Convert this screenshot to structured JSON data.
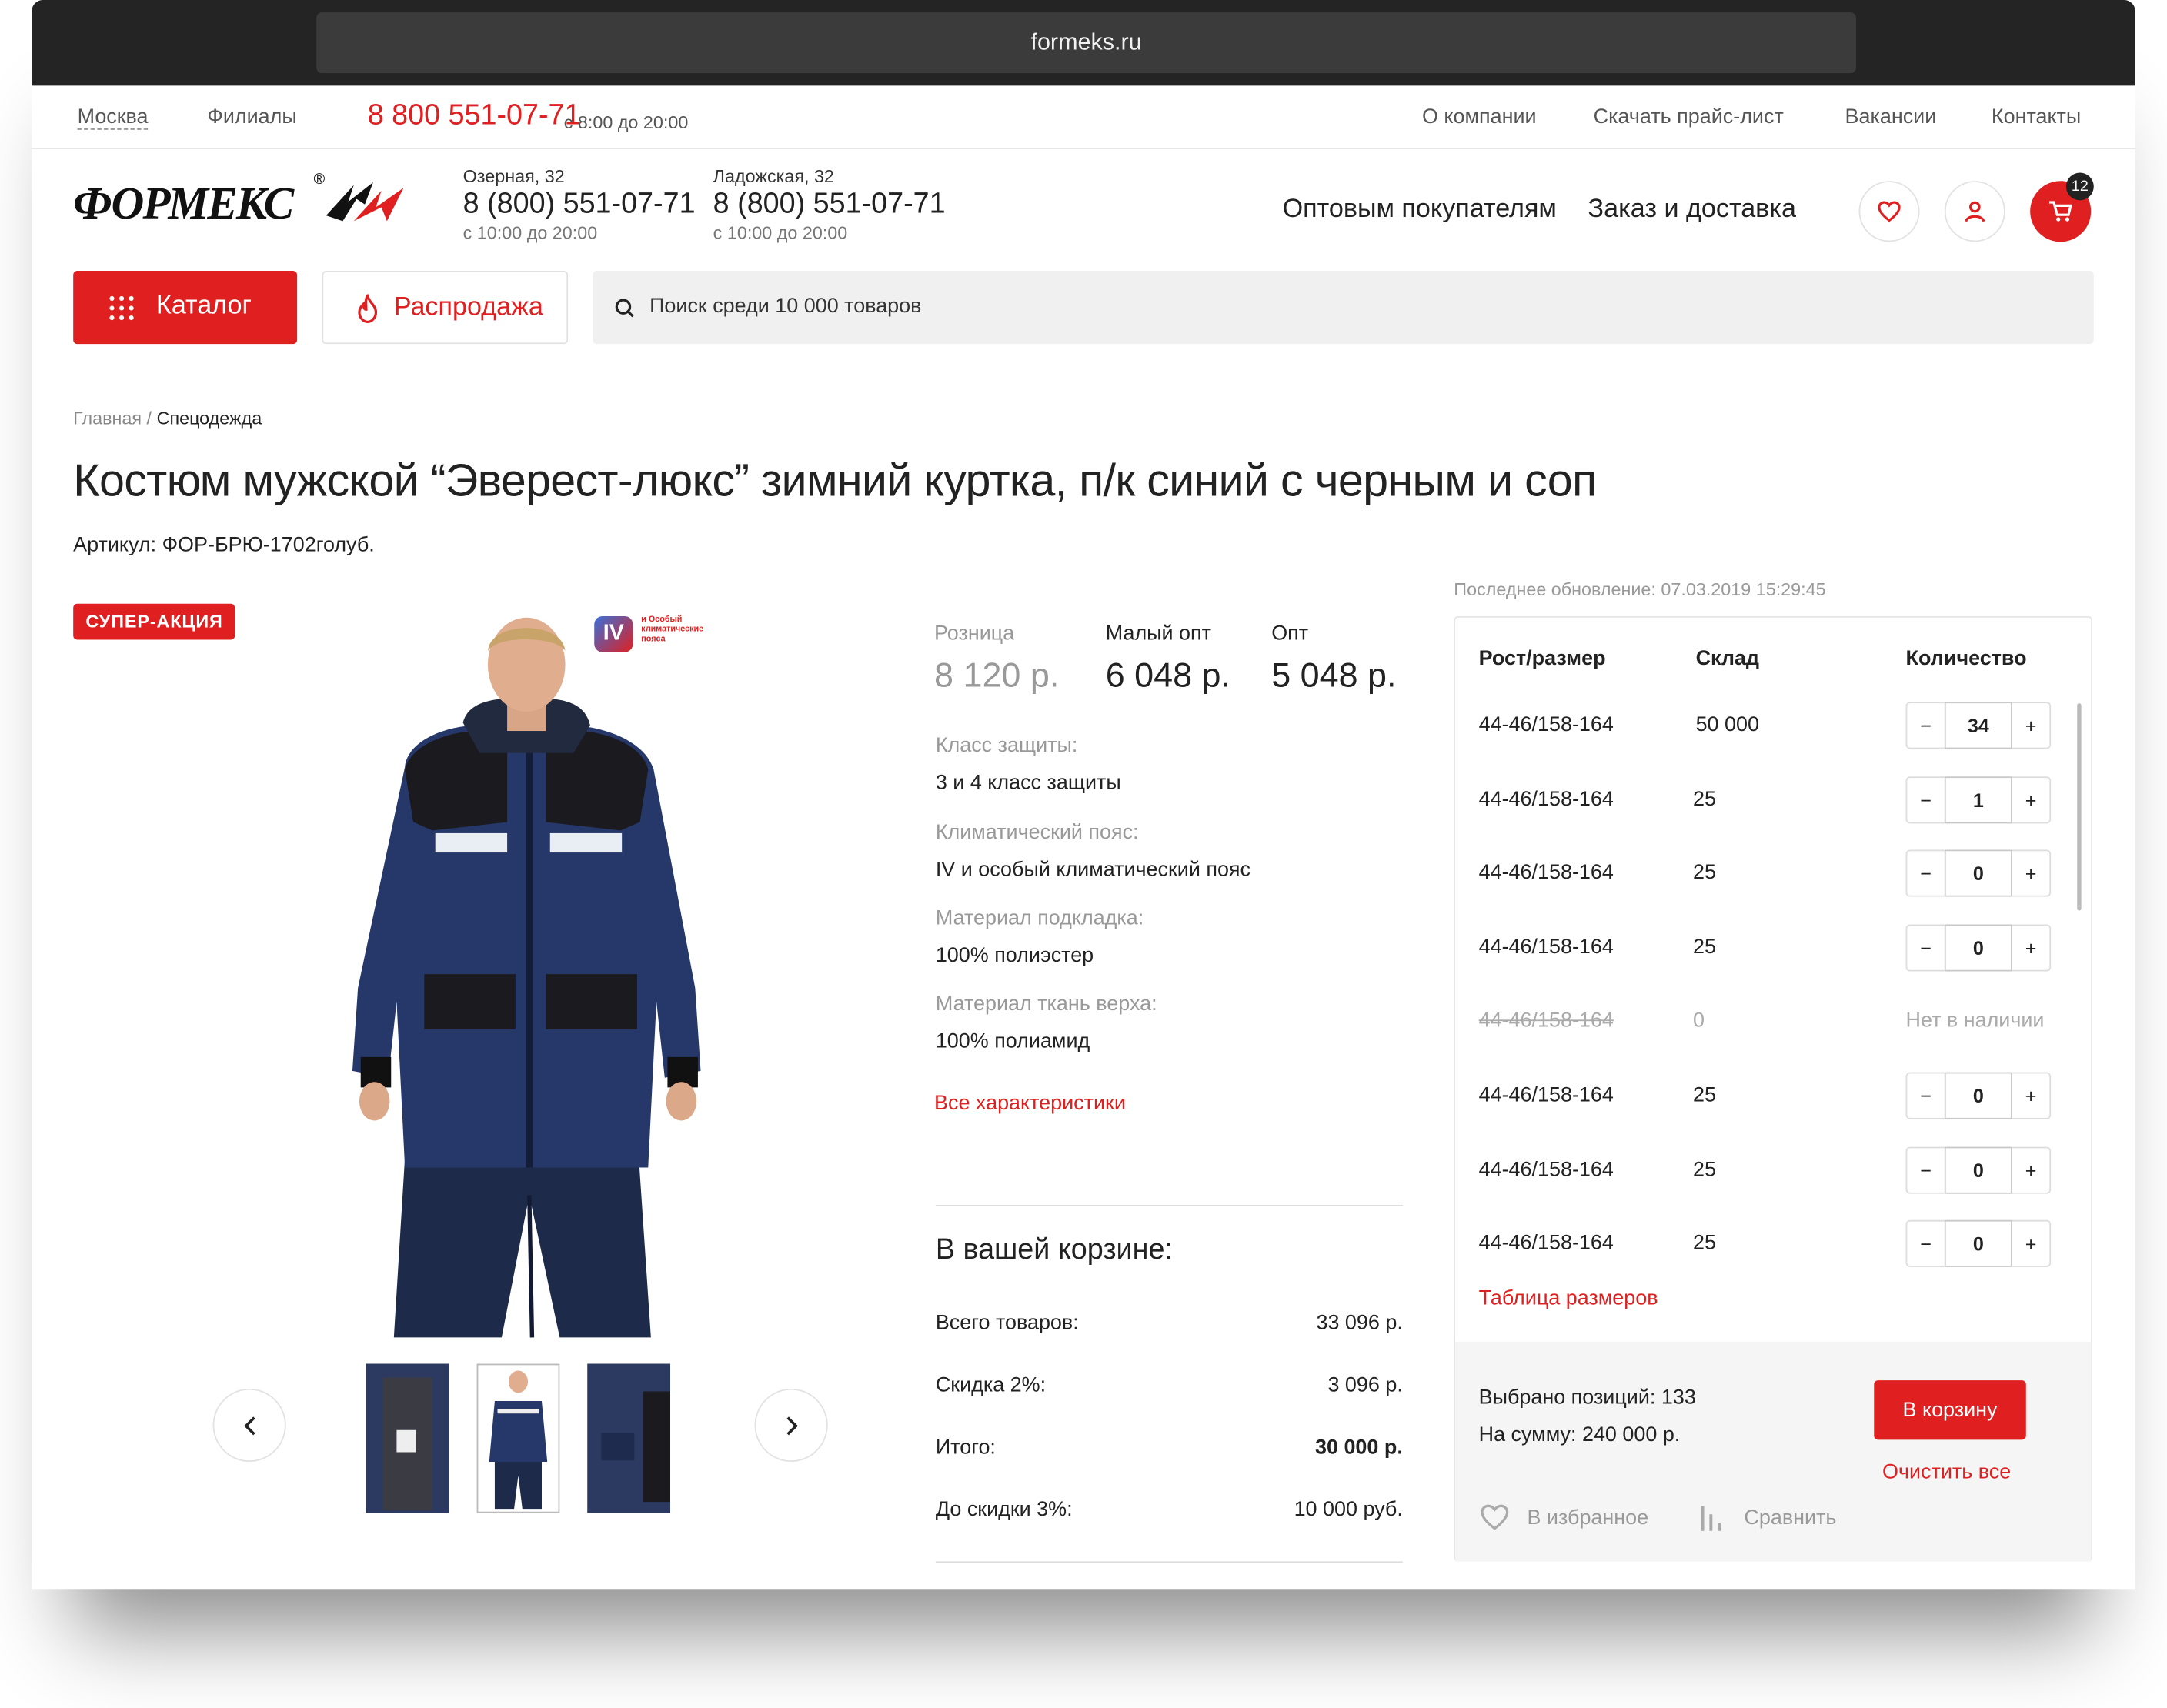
{
  "browser": {
    "url": "formeks.ru"
  },
  "topbar": {
    "city": "Москва",
    "branches": "Филиалы",
    "phone": "8 800 551-07-71",
    "hours": "с 8:00 до 20:00",
    "links": [
      "О компании",
      "Скачать прайс-лист",
      "Вакансии",
      "Контакты"
    ]
  },
  "header": {
    "logo_text": "ФОРМЕКС",
    "stores": [
      {
        "address": "Озерная, 32",
        "phone": "8 (800) 551-07-71",
        "hours": "с 10:00 до 20:00"
      },
      {
        "address": "Ладожская, 32",
        "phone": "8 (800) 551-07-71",
        "hours": "с 10:00 до 20:00"
      }
    ],
    "nav": [
      "Оптовым покупателям",
      "Заказ и доставка"
    ],
    "cart_count": "12"
  },
  "toolbar": {
    "catalog_label": "Каталог",
    "sale_label": "Распродажа",
    "search_placeholder": "Поиск среди 10 000 товаров"
  },
  "breadcrumb": {
    "home": "Главная",
    "separator": "/",
    "current": "Спецодежда"
  },
  "product": {
    "title": "Костюм мужской “Эверест-люкс” зимний куртка, п/к синий с черным и соп",
    "article": "Артикул: ФОР-БРЮ-1702голуб.",
    "badge": "СУПЕР-АКЦИЯ",
    "climate_badge": {
      "numeral": "IV",
      "text": "и Особый климатические пояса"
    },
    "prices": [
      {
        "label": "Розница",
        "value": "8 120 р."
      },
      {
        "label": "Малый опт",
        "value": "6 048 р."
      },
      {
        "label": "Опт",
        "value": "5 048 р."
      }
    ],
    "specs": [
      {
        "label": "Класс защиты:",
        "value": "3 и 4 класс защиты"
      },
      {
        "label": "Климатический пояс:",
        "value": "IV и особый климатический пояс"
      },
      {
        "label": "Материал подкладка:",
        "value": "100% полиэстер"
      },
      {
        "label": "Материал ткань верха:",
        "value": "100% полиамид"
      }
    ],
    "all_specs_link": "Все характеристики"
  },
  "cart_summary": {
    "title": "В вашей корзине:",
    "rows": [
      {
        "label": "Всего товаров:",
        "value": "33 096 р."
      },
      {
        "label": "Скидка 2%:",
        "value": "3 096 р."
      },
      {
        "label": "Итого:",
        "value": "30 000 р."
      },
      {
        "label": "До скидки 3%:",
        "value": "10 000 руб."
      }
    ]
  },
  "sizes": {
    "last_update": "Последнее обновление: 07.03.2019 15:29:45",
    "headers": [
      "Рост/размер",
      "Склад",
      "Количество"
    ],
    "rows": [
      {
        "size": "44-46/158-164",
        "stock": "50 000",
        "qty": "34"
      },
      {
        "size": "44-46/158-164",
        "stock": "25",
        "qty": "1"
      },
      {
        "size": "44-46/158-164",
        "stock": "25",
        "qty": "0"
      },
      {
        "size": "44-46/158-164",
        "stock": "25",
        "qty": "0"
      },
      {
        "size": "44-46/158-164",
        "stock": "0",
        "qty": "Нет в наличии"
      },
      {
        "size": "44-46/158-164",
        "stock": "25",
        "qty": "0"
      },
      {
        "size": "44-46/158-164",
        "stock": "25",
        "qty": "0"
      },
      {
        "size": "44-46/158-164",
        "stock": "25",
        "qty": "0"
      }
    ],
    "size_table_link": "Таблица размеров",
    "selected_label": "Выбрано позиций:",
    "selected_value": "133",
    "sum_label": "На сумму:",
    "sum_value": "240 000 р.",
    "add_to_cart": "В корзину",
    "clear_all": "Очистить все",
    "favorite": "В избранное",
    "compare": "Сравнить"
  },
  "colors": {
    "accent": "#e02020",
    "dark": "#242424"
  }
}
